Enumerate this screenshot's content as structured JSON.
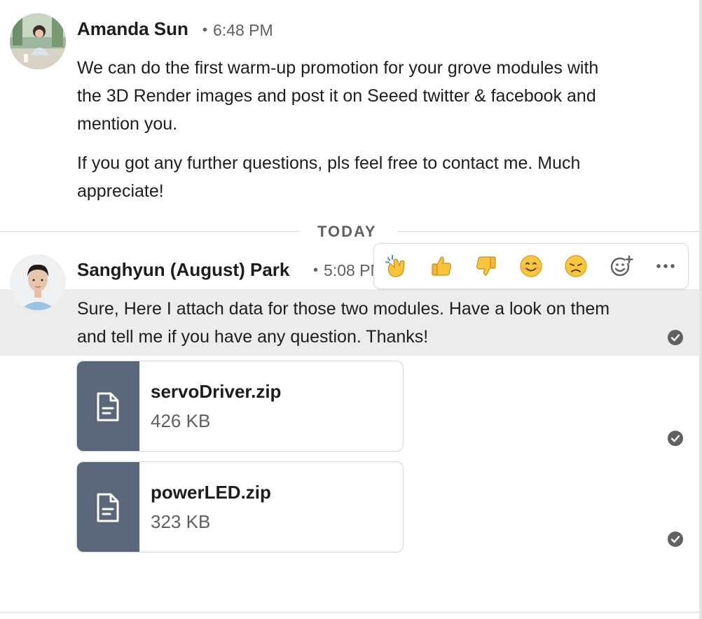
{
  "messages": [
    {
      "author": "Amanda Sun",
      "time": "6:48 PM",
      "paragraphs": [
        "We can do the first warm-up promotion for your grove modules with the 3D Render images and post it on Seeed twitter & facebook and mention you.",
        "If you got any further questions, pls feel free to contact me. Much appreciate!"
      ]
    },
    {
      "author": "Sanghyun (August) Park",
      "time": "5:08 PM",
      "paragraphs": [
        "Sure, Here I attach data for those two modules. Have a look on them and tell me if you have any question. Thanks!"
      ],
      "files": [
        {
          "name": "servoDriver.zip",
          "size": "426 KB"
        },
        {
          "name": "powerLED.zip",
          "size": "323 KB"
        }
      ]
    }
  ],
  "divider": {
    "label": "TODAY"
  },
  "reactions": [
    "clapping-hands",
    "thumbs-up",
    "thumbs-down",
    "smiling-face",
    "disappointed-face",
    "add-reaction",
    "more-actions"
  ],
  "colors": {
    "file_icon_bg": "#5a6679",
    "highlight_bg": "#ececec",
    "text": "#1d1d1f",
    "muted": "#616061"
  }
}
